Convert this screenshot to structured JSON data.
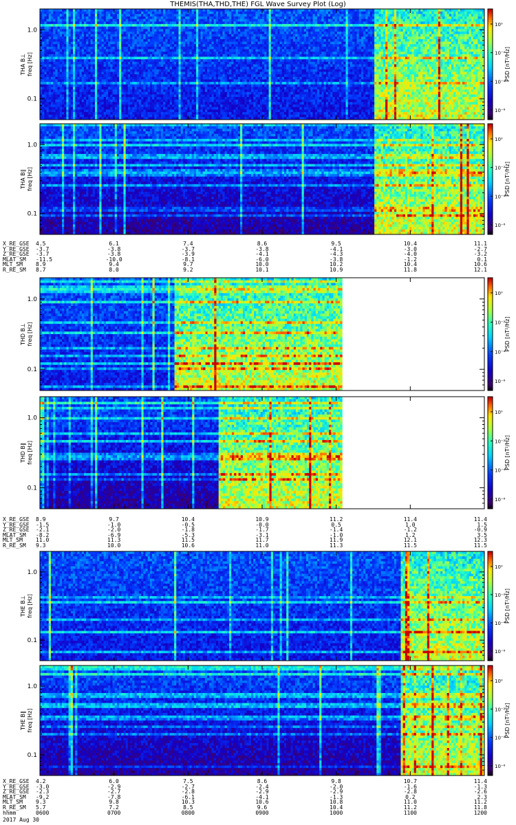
{
  "title": "THEMIS(THA,THD,THE) FGL Wave Survey Plot (Log)",
  "colorbar_label": "PSD [nT²/Hz]",
  "colorbar_ticks": [
    "10⁰",
    "10⁻²",
    "10⁻⁴",
    "10⁻⁶"
  ],
  "ytick_labels": [
    "1.0",
    "0.1"
  ],
  "date_label": "2017 Aug 30",
  "chart_data": [
    {
      "type": "heatmap",
      "probe": "THA",
      "ylabel_top": "THA B⊥",
      "ylabel_bottom": "freq [Hz]",
      "ylim_hz": [
        0.05,
        2.0
      ],
      "xrange_hhmm": [
        "0600",
        "1200"
      ],
      "data_end_fraction": 1.0,
      "active_start_fraction": 0.75
    },
    {
      "type": "heatmap",
      "probe": "THA",
      "ylabel_top": "THA B∥",
      "ylabel_bottom": "freq [Hz]",
      "ylim_hz": [
        0.05,
        2.0
      ],
      "xrange_hhmm": [
        "0600",
        "1200"
      ],
      "data_end_fraction": 1.0,
      "active_start_fraction": 0.75
    },
    {
      "type": "heatmap",
      "probe": "THD",
      "ylabel_top": "THD B⊥",
      "ylabel_bottom": "freq [Hz]",
      "ylim_hz": [
        0.05,
        2.0
      ],
      "xrange_hhmm": [
        "0600",
        "1200"
      ],
      "data_end_fraction": 0.68,
      "active_start_fraction": 0.3
    },
    {
      "type": "heatmap",
      "probe": "THD",
      "ylabel_top": "THD B∥",
      "ylabel_bottom": "freq [Hz]",
      "ylim_hz": [
        0.05,
        2.0
      ],
      "xrange_hhmm": [
        "0600",
        "1200"
      ],
      "data_end_fraction": 0.68,
      "active_start_fraction": 0.4
    },
    {
      "type": "heatmap",
      "probe": "THE",
      "ylabel_top": "THE B⊥",
      "ylabel_bottom": "freq [Hz]",
      "ylim_hz": [
        0.05,
        2.0
      ],
      "xrange_hhmm": [
        "0600",
        "1200"
      ],
      "data_end_fraction": 1.0,
      "active_start_fraction": 0.81
    },
    {
      "type": "heatmap",
      "probe": "THE",
      "ylabel_top": "THE B∥",
      "ylabel_bottom": "freq [Hz]",
      "ylim_hz": [
        0.05,
        2.0
      ],
      "xrange_hhmm": [
        "0600",
        "1200"
      ],
      "data_end_fraction": 1.0,
      "active_start_fraction": 0.81
    }
  ],
  "ephemeris": [
    {
      "labels": [
        "X_RE_GSE",
        "Y_RE_GSE",
        "Z_RE_GSE",
        "MLAT_SM",
        "MLT_SM",
        "R_RE_SM"
      ],
      "columns": [
        [
          "4.5",
          "-3.7",
          "-3.7",
          "-11.5",
          "8.9",
          "8.7"
        ],
        [
          "6.1",
          "-3.8",
          "-3.8",
          "-10.0",
          "9.4",
          "8.0"
        ],
        [
          "7.4",
          "-3.7",
          "-3.9",
          "-8.1",
          "9.7",
          "9.2"
        ],
        [
          "8.6",
          "-3.8",
          "-4.1",
          "-6.0",
          "10.0",
          "10.1"
        ],
        [
          "9.5",
          "-4.1",
          "-4.3",
          "-3.8",
          "10.2",
          "10.9"
        ],
        [
          "10.4",
          "-3.0",
          "-4.0",
          "-1.2",
          "10.4",
          "11.8"
        ],
        [
          "11.1",
          "-2.7",
          "-3.2",
          "0.1",
          "10.6",
          "12.1"
        ]
      ]
    },
    {
      "labels": [
        "X_RE_GSE",
        "Y_RE_GSE",
        "Z_RE_GSE",
        "MLAT_SM",
        "MLT_SM",
        "R_RE_SM"
      ],
      "columns": [
        [
          "8.9",
          "-1.5",
          "-2.1",
          "-8.2",
          "11.0",
          "9.3"
        ],
        [
          "9.7",
          "-1.0",
          "-2.0",
          "-6.9",
          "11.3",
          "10.0"
        ],
        [
          "10.4",
          "-0.5",
          "-1.8",
          "-5.3",
          "11.5",
          "10.6"
        ],
        [
          "10.9",
          "-0.0",
          "-1.7",
          "-3.1",
          "11.7",
          "11.0"
        ],
        [
          "11.2",
          "0.5",
          "-1.4",
          "-1.0",
          "11.9",
          "11.3"
        ],
        [
          "11.4",
          "1.0",
          "-1.2",
          "1.2",
          "12.1",
          "11.5"
        ],
        [
          "11.4",
          "1.5",
          "-0.9",
          "3.5",
          "12.3",
          "11.5"
        ]
      ]
    },
    {
      "labels": [
        "X_RE_GSE",
        "Y_RE_GSE",
        "Z_RE_GSE",
        "MLAT_SM",
        "MLT_SM",
        "R_RE_SM",
        "hhmm"
      ],
      "columns": [
        [
          "4.2",
          "-3.0",
          "-2.3",
          "-9.2",
          "9.3",
          "5.7",
          "0600"
        ],
        [
          "6.0",
          "-2.9",
          "-2.7",
          "-7.8",
          "9.8",
          "7.2",
          "0700"
        ],
        [
          "7.5",
          "-2.7",
          "-2.8",
          "-6.1",
          "10.3",
          "8.5",
          "0800"
        ],
        [
          "8.6",
          "-2.4",
          "-2.9",
          "-4.1",
          "10.6",
          "9.6",
          "0900"
        ],
        [
          "9.8",
          "-2.0",
          "-2.9",
          "-1.3",
          "10.8",
          "10.4",
          "1000"
        ],
        [
          "10.7",
          "-1.6",
          "-2.8",
          "0.2",
          "11.0",
          "11.2",
          "1100"
        ],
        [
          "11.4",
          "-1.3",
          "-2.6",
          "2.3",
          "11.2",
          "11.8",
          "1200"
        ]
      ]
    }
  ]
}
